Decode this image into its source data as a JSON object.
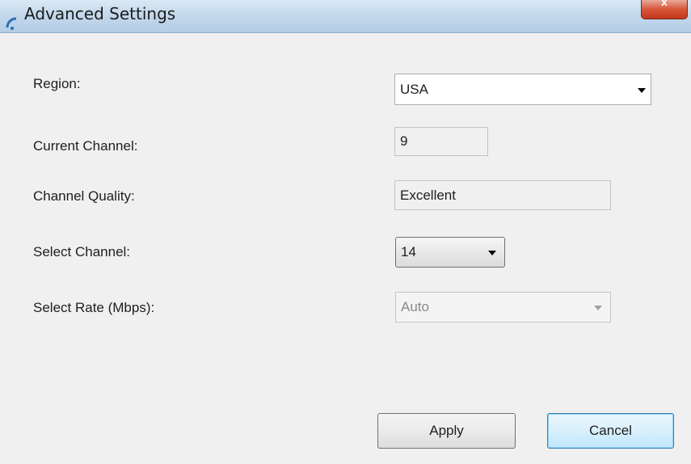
{
  "window": {
    "title": "Advanced Settings",
    "close_glyph": "x"
  },
  "form": {
    "region": {
      "label": "Region:",
      "value": "USA"
    },
    "current_channel": {
      "label": "Current Channel:",
      "value": "9"
    },
    "channel_quality": {
      "label": "Channel Quality:",
      "value": "Excellent"
    },
    "select_channel": {
      "label": "Select Channel:",
      "value": "14"
    },
    "select_rate": {
      "label": "Select Rate (Mbps):",
      "value": "Auto",
      "disabled": true
    }
  },
  "buttons": {
    "apply_label": "Apply",
    "cancel_label": "Cancel"
  },
  "icons": {
    "app": "wifi-signal-icon",
    "close": "close-icon",
    "dropdown": "chevron-down-icon"
  },
  "colors": {
    "titlebar": "#c3d8ec",
    "close_button": "#d7553a",
    "dialog_bg": "#f0f0f0",
    "focus_button_border": "#3c7fb1"
  }
}
